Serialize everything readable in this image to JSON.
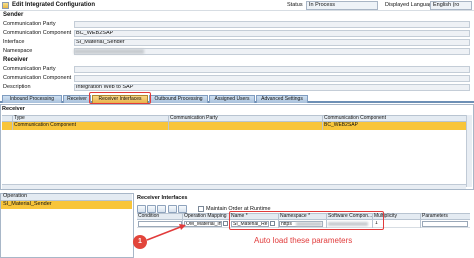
{
  "window": {
    "title": "Edit Integrated Configuration",
    "status_label": "Status",
    "status_value": "In Process",
    "language_label": "Displayed Language",
    "language_value": "English (ro"
  },
  "sender": {
    "section": "Sender",
    "party_label": "Communication Party",
    "party_value": "",
    "component_label": "Communication Component",
    "component_value": "BC_WEB2SAP",
    "interface_label": "Interface",
    "interface_value": "SI_Material_Sender",
    "namespace_label": "Namespace"
  },
  "receiver": {
    "section": "Receiver",
    "party_label": "Communication Party",
    "component_label": "Communication Component",
    "description_label": "Description",
    "description_value": "Integration Web to SAP"
  },
  "tabs": [
    {
      "label": "Inbound Processing"
    },
    {
      "label": "Receiver"
    },
    {
      "label": "Receiver Interfaces"
    },
    {
      "label": "Outbound Processing"
    },
    {
      "label": "Assigned Users"
    },
    {
      "label": "Advanced Settings"
    }
  ],
  "receiver_table": {
    "header": "Receiver",
    "columns": [
      "Type",
      "Communication Party",
      "Communication Component"
    ],
    "rows": [
      [
        "Communication Component",
        "",
        "BC_WEB2SAP"
      ]
    ]
  },
  "operations": {
    "header": "Operation",
    "rows": [
      "SI_Material_Sender"
    ]
  },
  "receiver_interfaces": {
    "header": "Receiver Interfaces",
    "maintain_order_label": "Maintain Order at Runtime",
    "columns": [
      "Condition",
      "Operation Mapping",
      "Name *",
      "Namespace *",
      "Software Compon...",
      "Multiplicity",
      "Parameters"
    ],
    "row": {
      "condition": "",
      "operation_mapping": "OM_Material_In",
      "name": "SI_Material_Re",
      "namespace": "https",
      "multiplicity": "1"
    }
  },
  "annotation": {
    "step": "1",
    "text": "Auto load these parameters",
    "color": "#e13b3b"
  }
}
